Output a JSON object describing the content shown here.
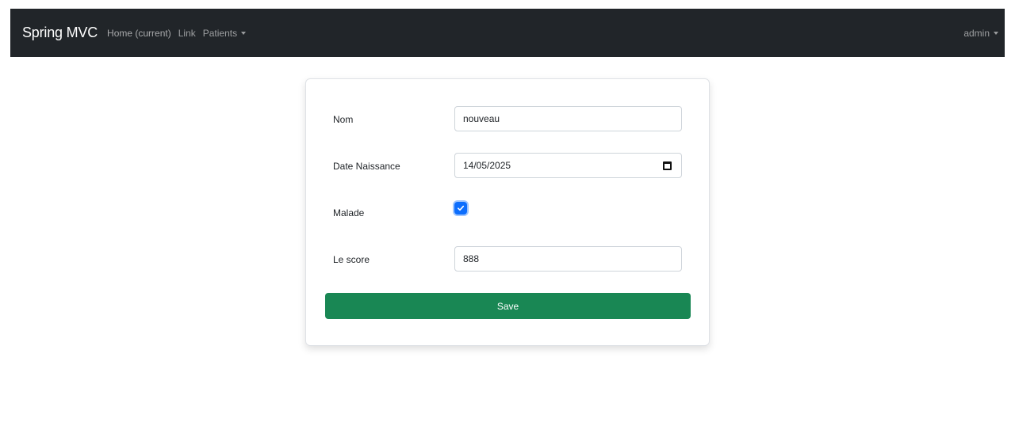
{
  "navbar": {
    "brand": "Spring MVC",
    "links": [
      "Home (current)",
      "Link",
      "Patients"
    ],
    "user": "admin"
  },
  "form": {
    "nom": {
      "label": "Nom",
      "value": "nouveau"
    },
    "date": {
      "label": "Date Naissance",
      "value": "14/05/2025"
    },
    "malade": {
      "label": "Malade",
      "checked": true
    },
    "score": {
      "label": "Le score",
      "value": "888"
    },
    "save_label": "Save"
  },
  "colors": {
    "navbar_bg": "#212529",
    "primary": "#0d6efd",
    "success": "#198754"
  }
}
